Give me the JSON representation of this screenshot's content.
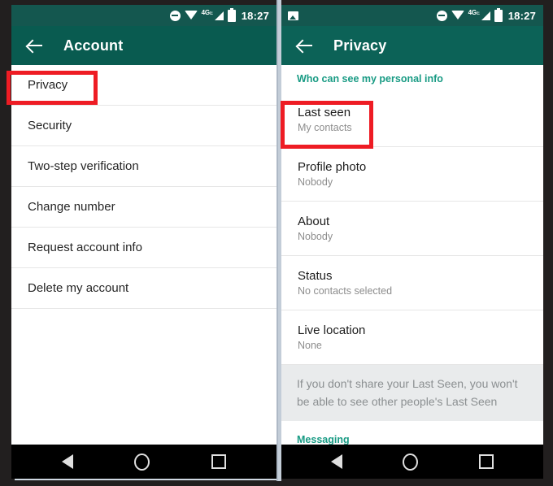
{
  "status_bar": {
    "time": "18:27",
    "network_label": "4G",
    "network_sub": "E",
    "icons_left_panel": [
      "dnd-icon",
      "wifi-icon",
      "network-4g-label",
      "signal-icon",
      "battery-icon"
    ],
    "icons_right_panel": [
      "photo-notification-icon",
      "dnd-icon",
      "wifi-icon",
      "network-4g-label",
      "signal-icon",
      "battery-icon"
    ]
  },
  "colors": {
    "appbar_green": "#095b50",
    "statusbar_green": "#14574f",
    "section_teal": "#199b84",
    "annotation_red": "#ee1c24",
    "banner_gray": "#e9ebec"
  },
  "left_panel": {
    "title": "Account",
    "back_icon": "back-arrow-icon",
    "items": [
      {
        "label": "Privacy",
        "highlighted": true
      },
      {
        "label": "Security",
        "highlighted": false
      },
      {
        "label": "Two-step verification",
        "highlighted": false
      },
      {
        "label": "Change number",
        "highlighted": false
      },
      {
        "label": "Request account info",
        "highlighted": false
      },
      {
        "label": "Delete my account",
        "highlighted": false
      }
    ]
  },
  "right_panel": {
    "title": "Privacy",
    "back_icon": "back-arrow-icon",
    "section_personal_info": "Who can see my personal info",
    "items": [
      {
        "label": "Last seen",
        "value": "My contacts",
        "highlighted": true
      },
      {
        "label": "Profile photo",
        "value": "Nobody",
        "highlighted": false
      },
      {
        "label": "About",
        "value": "Nobody",
        "highlighted": false
      },
      {
        "label": "Status",
        "value": "No contacts selected",
        "highlighted": false
      },
      {
        "label": "Live location",
        "value": "None",
        "highlighted": false
      }
    ],
    "info_banner": "If you don't share your Last Seen, you won't be able to see other people's Last Seen",
    "section_messaging": "Messaging"
  },
  "nav_bar": {
    "back": "nav-back-icon",
    "home": "nav-home-icon",
    "recents": "nav-recents-icon"
  }
}
